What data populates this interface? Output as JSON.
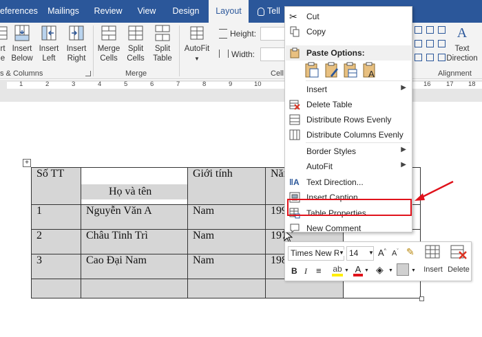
{
  "tabs": [
    "eferences",
    "Mailings",
    "Review",
    "View",
    "Design",
    "Layout",
    "Tell"
  ],
  "ribbon": {
    "rows_columns": {
      "delete_cut": "rt",
      "delete_cut2": "e",
      "insert_below": [
        "Insert",
        "Below"
      ],
      "insert_left": [
        "Insert",
        "Left"
      ],
      "insert_right": [
        "Insert",
        "Right"
      ],
      "group_label": "s & Columns"
    },
    "merge": {
      "merge_cells": [
        "Merge",
        "Cells"
      ],
      "split_cells": [
        "Split",
        "Cells"
      ],
      "split_table": [
        "Split",
        "Table"
      ],
      "group_label": "Merge"
    },
    "cell_size": {
      "autofit": "AutoFit",
      "height_label": "Height:",
      "width_label": "Width:",
      "group_label": "Cell"
    },
    "alignment": {
      "text_direction": [
        "Text",
        "Direction"
      ],
      "group_label": "Alignment"
    }
  },
  "ruler": {
    "numbers": [
      "1",
      "2",
      "3",
      "4",
      "5",
      "6",
      "7",
      "8",
      "9",
      "10",
      "16",
      "17",
      "18"
    ]
  },
  "table": {
    "rows": [
      [
        "Số TT",
        "Họ và tên",
        "Giới tính",
        "Năm"
      ],
      [
        "1",
        "Nguyễn Văn A",
        "Nam",
        "199"
      ],
      [
        "2",
        "Châu Tinh Trì",
        "Nam",
        "197"
      ],
      [
        "3",
        "Cao Đại Nam",
        "Nam",
        "198"
      ],
      [
        "",
        "",
        "",
        ""
      ]
    ]
  },
  "context_menu": {
    "cut": "Cut",
    "copy": "Copy",
    "paste_options": "Paste Options:",
    "insert": "Insert",
    "delete_table": "Delete Table",
    "distribute_rows": "Distribute Rows Evenly",
    "distribute_columns": "Distribute Columns Evenly",
    "border_styles": "Border Styles",
    "autofit": "AutoFit",
    "text_direction": "Text Direction...",
    "insert_caption": "Insert Caption...",
    "table_properties": "Table Properties...",
    "new_comment": "New Comment"
  },
  "mini_toolbar": {
    "font_name": "Times New Ro",
    "font_size": "14",
    "insert_label": "Insert",
    "delete_label": "Delete"
  },
  "colors": {
    "ribbon_blue": "#2b579a",
    "highlight_red": "#e0121b",
    "selected_cell": "#d6d6d6"
  }
}
